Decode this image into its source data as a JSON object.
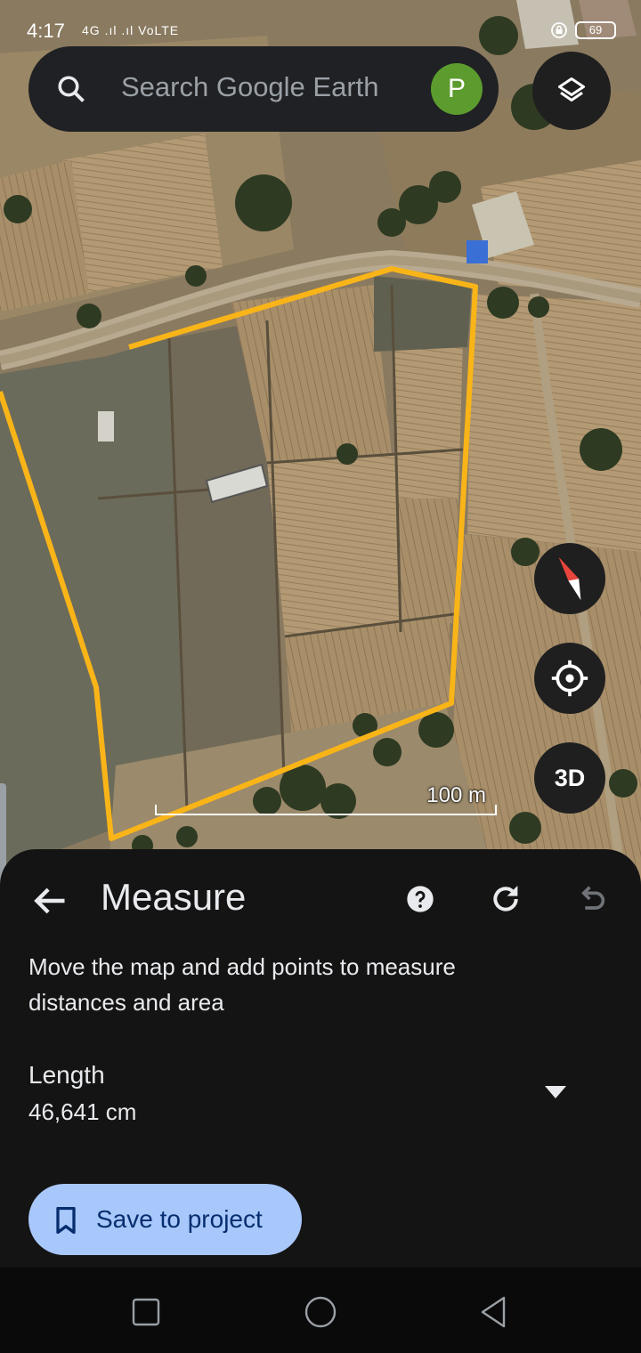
{
  "status_bar": {
    "time": "4:17",
    "network": "4G .ıl .ıl VoLTE",
    "battery": "69"
  },
  "search": {
    "placeholder": "Search Google Earth",
    "avatar_initial": "P",
    "avatar_color": "#5c9c2e"
  },
  "map": {
    "scale_label": "100 m",
    "measure_line_color": "#f9b418",
    "three_d_label": "3D"
  },
  "icons": {
    "search": "search-icon",
    "layers": "layers-icon",
    "compass": "compass-icon",
    "locate": "my-location-icon",
    "back": "arrow-back-icon",
    "help": "help-icon",
    "redo": "redo-icon",
    "undo": "undo-icon",
    "dropdown": "caret-down-icon",
    "bookmark": "bookmark-icon"
  },
  "panel": {
    "title": "Measure",
    "instruction": "Move the map and add points to measure distances and area",
    "metric_label": "Length",
    "metric_value": "46,641 cm",
    "save_label": "Save to project",
    "save_color": "#a8c7fa"
  }
}
